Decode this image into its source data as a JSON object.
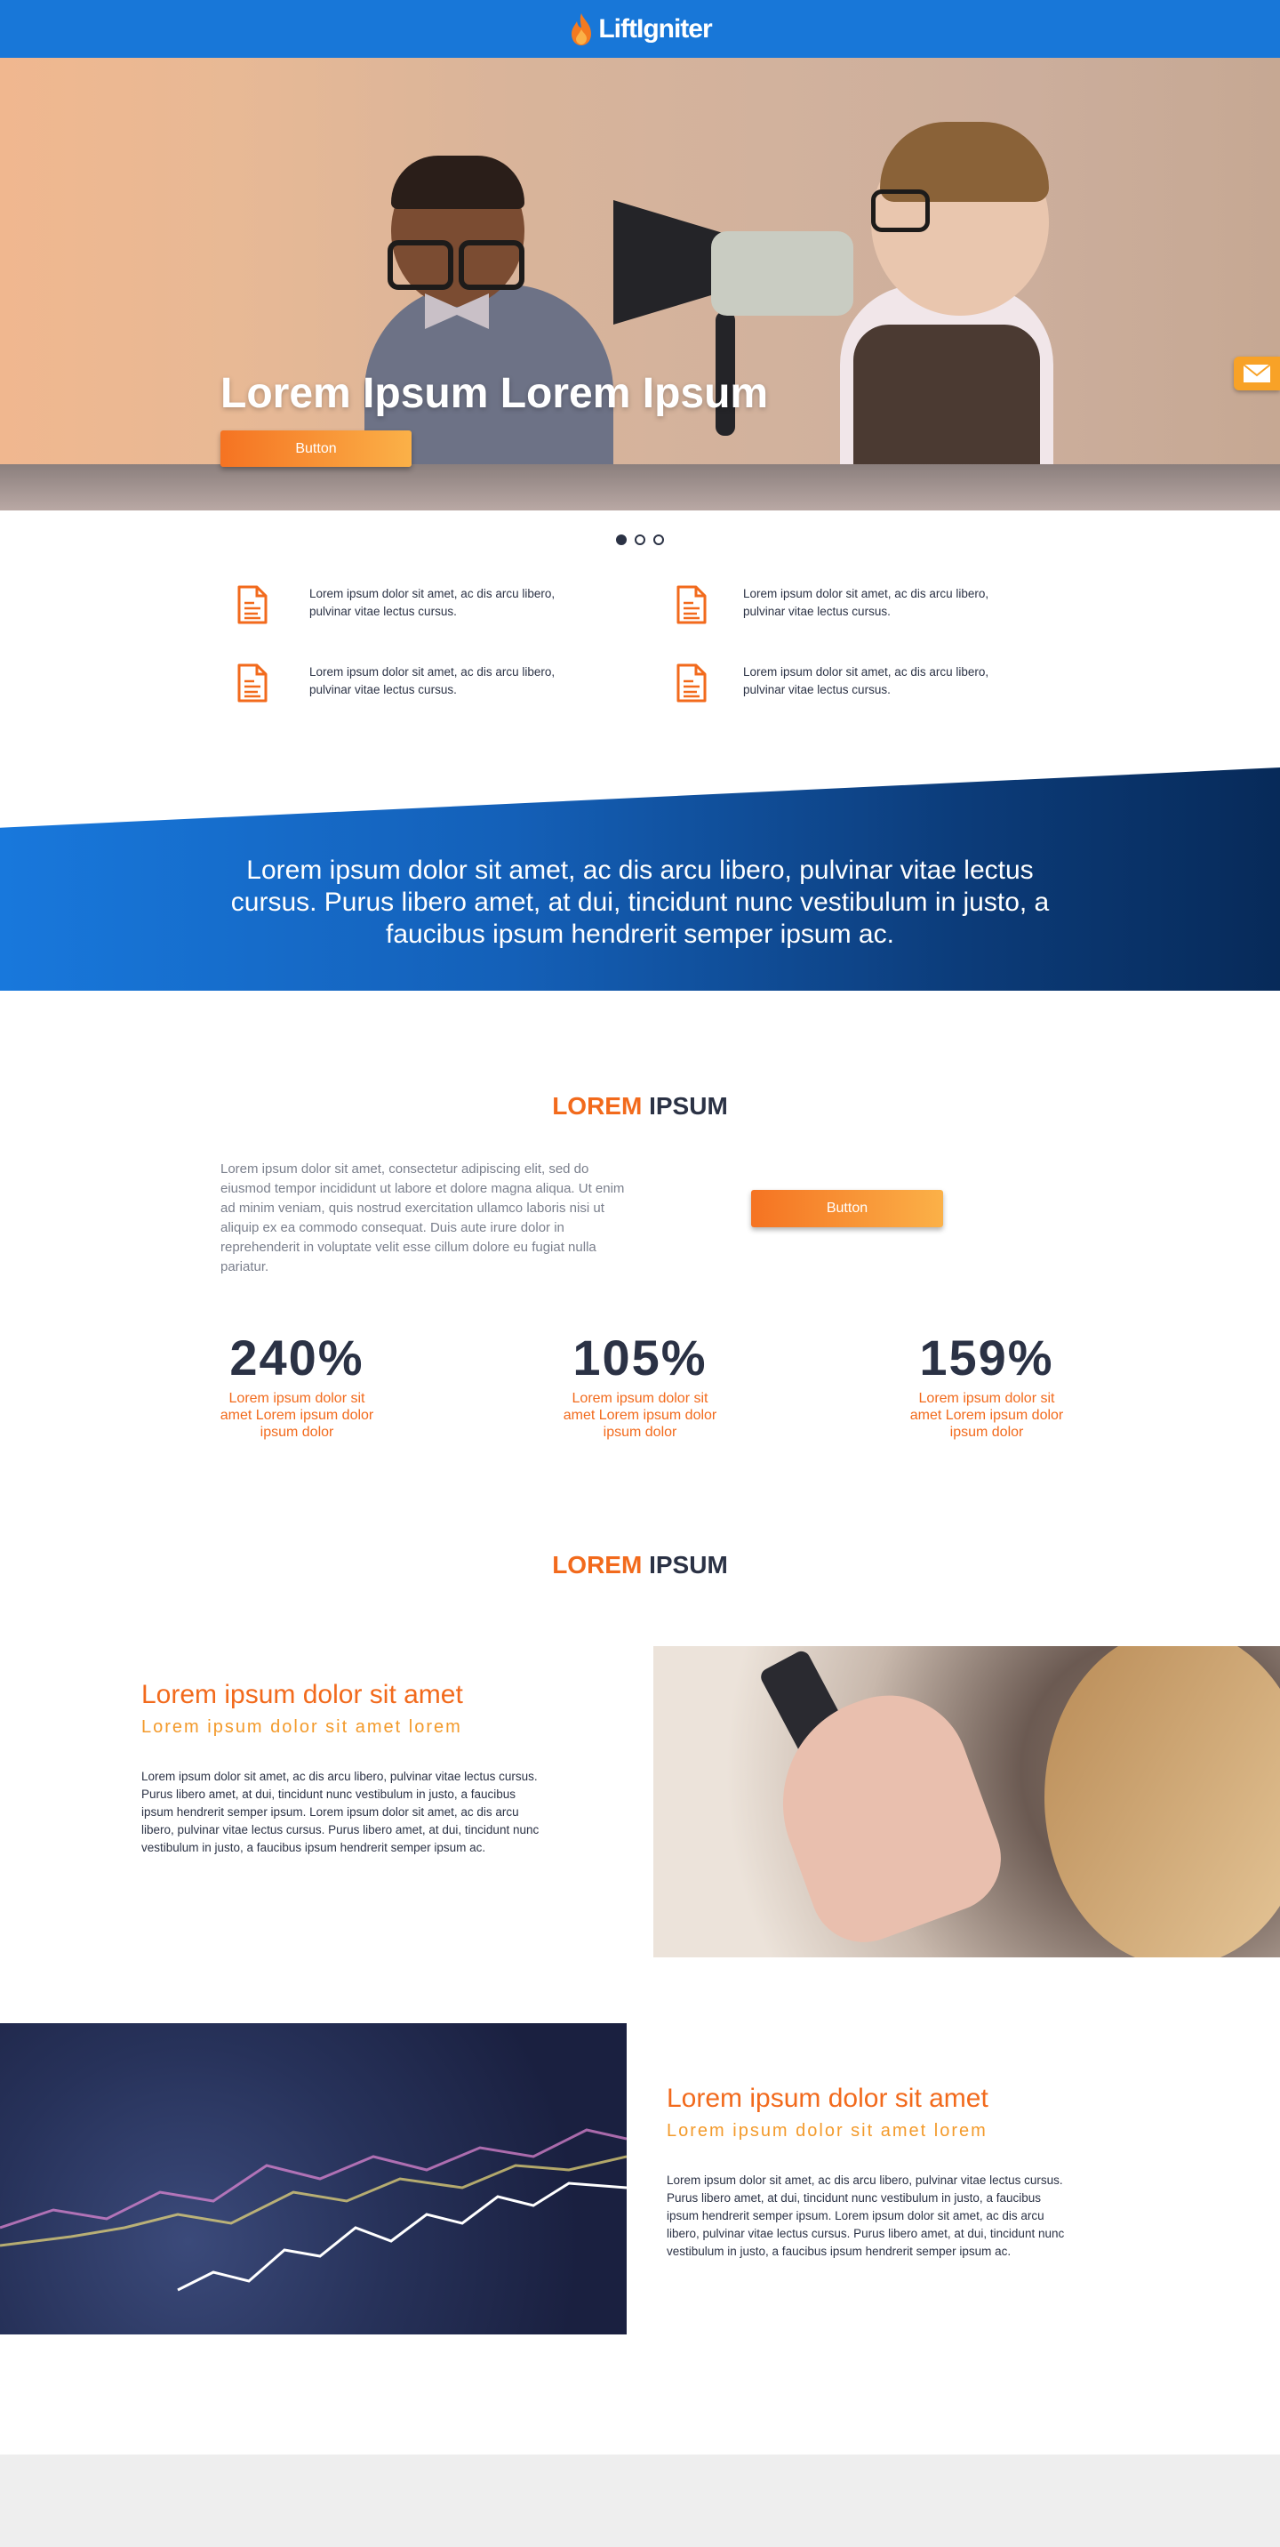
{
  "header": {
    "logo_text": "LiftIgniter",
    "brand_color": "#1877d8",
    "accent_color": "#f26a1c"
  },
  "hero": {
    "title": "Lorem Ipsum Lorem Ipsum",
    "button_label": "Button",
    "mail_icon": "mail-icon"
  },
  "carousel": {
    "slide_count": 3,
    "active_index": 0
  },
  "features": [
    {
      "icon": "document-icon",
      "text": "Lorem ipsum dolor sit amet, ac dis arcu libero, pulvinar vitae lectus cursus."
    },
    {
      "icon": "document-icon",
      "text": "Lorem ipsum dolor sit amet, ac dis arcu libero, pulvinar vitae lectus cursus."
    },
    {
      "icon": "document-icon",
      "text": "Lorem ipsum dolor sit amet, ac dis arcu libero, pulvinar vitae lectus cursus."
    },
    {
      "icon": "document-icon",
      "text": "Lorem ipsum dolor sit amet, ac dis arcu libero, pulvinar vitae lectus cursus."
    }
  ],
  "banner": {
    "text": "Lorem ipsum dolor sit amet, ac dis arcu libero, pulvinar vitae lectus cursus. Purus libero amet, at dui, tincidunt nunc vestibulum in justo, a faucibus ipsum hendrerit semper ipsum ac."
  },
  "section1": {
    "title_accent": "LOREM",
    "title_rest": " IPSUM",
    "intro_text": "Lorem ipsum dolor sit amet, consectetur adipiscing elit, sed do eiusmod tempor incididunt ut labore et dolore magna aliqua. Ut enim ad minim veniam, quis nostrud exercitation ullamco laboris nisi ut aliquip ex ea commodo consequat. Duis aute irure dolor in reprehenderit in voluptate velit esse cillum dolore eu fugiat nulla pariatur.",
    "button_label": "Button",
    "stats": [
      {
        "value": "240%",
        "label": "Lorem ipsum dolor sit amet Lorem ipsum dolor ipsum dolor"
      },
      {
        "value": "105%",
        "label": "Lorem ipsum dolor sit amet Lorem ipsum dolor ipsum dolor"
      },
      {
        "value": "159%",
        "label": "Lorem ipsum dolor sit amet Lorem ipsum dolor ipsum dolor"
      }
    ]
  },
  "section2": {
    "title_accent": "LOREM",
    "title_rest": " IPSUM",
    "rows": [
      {
        "title": "Lorem ipsum dolor sit amet",
        "subtitle": "Lorem ipsum dolor sit amet lorem",
        "body": "Lorem ipsum dolor sit amet, ac dis arcu libero, pulvinar vitae lectus cursus. Purus libero amet, at dui, tincidunt nunc vestibulum in justo, a faucibus ipsum hendrerit semper ipsum. Lorem ipsum dolor sit amet, ac dis arcu libero, pulvinar vitae lectus cursus. Purus libero amet, at dui, tincidunt nunc vestibulum in justo, a faucibus ipsum hendrerit semper ipsum ac."
      },
      {
        "title": "Lorem ipsum dolor sit amet",
        "subtitle": "Lorem ipsum dolor sit amet lorem",
        "body": "Lorem ipsum dolor sit amet, ac dis arcu libero, pulvinar vitae lectus cursus. Purus libero amet, at dui, tincidunt nunc vestibulum in justo, a faucibus ipsum hendrerit semper ipsum. Lorem ipsum dolor sit amet, ac dis arcu libero, pulvinar vitae lectus cursus. Purus libero amet, at dui, tincidunt nunc vestibulum in justo, a faucibus ipsum hendrerit semper ipsum ac."
      }
    ]
  }
}
